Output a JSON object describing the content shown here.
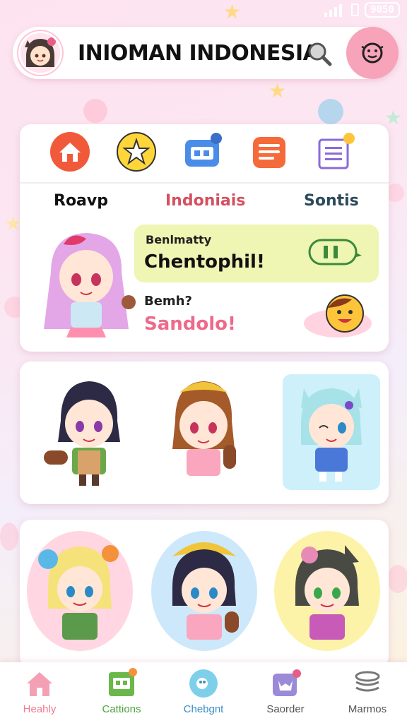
{
  "status_bar": {
    "time": "9050"
  },
  "header": {
    "title": "INIOMAN INDONESIA"
  },
  "feature_icons": [
    "home-icon",
    "star-badge-icon",
    "media-icon",
    "notes-icon",
    "list-icon"
  ],
  "tabs": [
    {
      "label": "Roavp",
      "active": false
    },
    {
      "label": "Indoniais",
      "active": true
    },
    {
      "label": "Sontis",
      "active": false
    }
  ],
  "chat": {
    "bubble_small": "Benlmatty",
    "bubble_big": "Chentophil!",
    "question": "Bemh?",
    "answer": "Sandolo!"
  },
  "bottom_nav": [
    {
      "label": "Heahly",
      "icon": "home-icon",
      "color": "#f07a93"
    },
    {
      "label": "Cattions",
      "icon": "game-icon",
      "color": "#4fa042"
    },
    {
      "label": "Chebgnt",
      "icon": "chat-icon",
      "color": "#3a8fc8"
    },
    {
      "label": "Saorder",
      "icon": "cat-icon",
      "color": "#555"
    },
    {
      "label": "Marmos",
      "icon": "stack-icon",
      "color": "#555"
    }
  ],
  "colors": {
    "accent": "#f7a3b9",
    "active_tab": "#d5505f",
    "bubble": "#eff5b2"
  }
}
